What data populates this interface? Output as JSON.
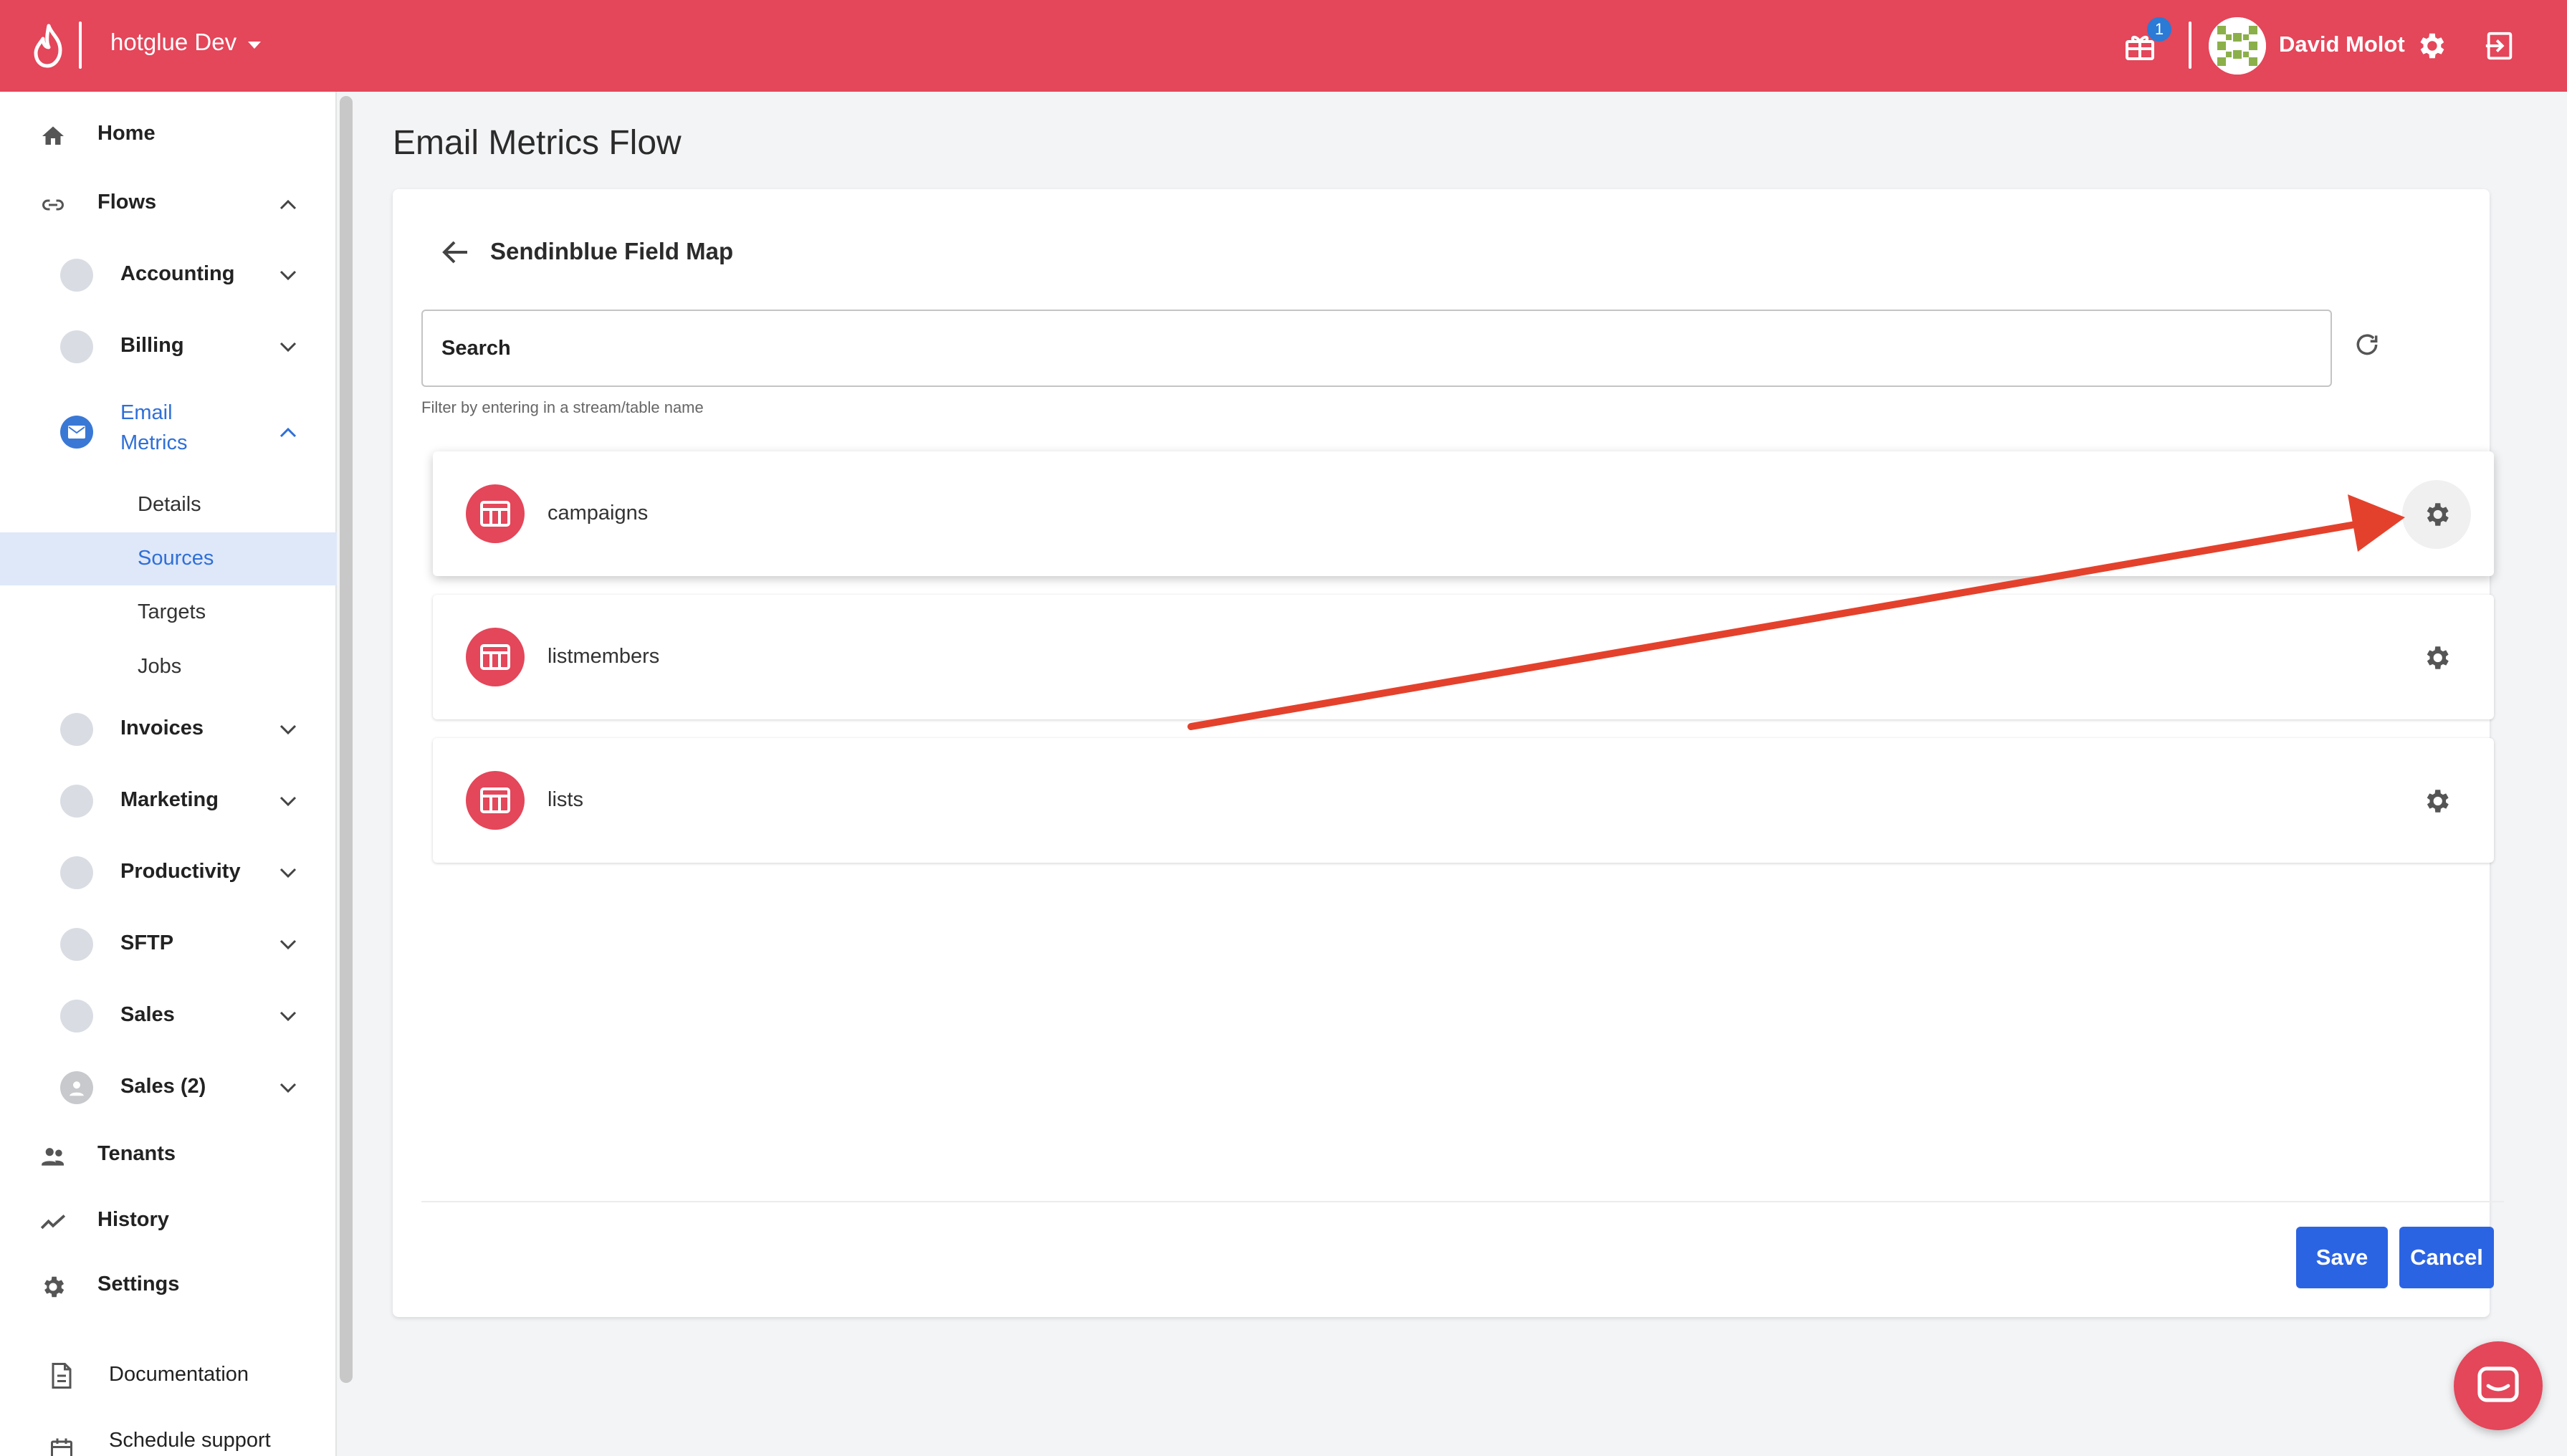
{
  "header": {
    "workspace": "hotglue Dev",
    "notification_count": "1",
    "user_name": "David Molot",
    "icons": [
      "flame-logo-icon",
      "caret-down-icon",
      "gift-icon",
      "gear-icon",
      "logout-icon"
    ],
    "brand_color": "#e4465a"
  },
  "sidebar": {
    "top_items": [
      {
        "label": "Home",
        "icon": "home-icon"
      },
      {
        "label": "Flows",
        "icon": "link-icon",
        "expanded": true
      }
    ],
    "flows": [
      {
        "label": "Accounting",
        "icon": "accounting-app-icon"
      },
      {
        "label": "Billing",
        "icon": "billing-app-icon"
      },
      {
        "label": "Email Metrics",
        "label_line1": "Email",
        "label_line2": "Metrics",
        "icon": "email-app-icon",
        "expanded": true,
        "active": true
      },
      {
        "label": "Invoices",
        "icon": "invoices-app-icon"
      },
      {
        "label": "Marketing",
        "icon": "marketing-app-icon"
      },
      {
        "label": "Productivity",
        "icon": "productivity-app-icon"
      },
      {
        "label": "SFTP",
        "icon": "sftp-app-icon"
      },
      {
        "label": "Sales",
        "icon": "sales-app-icon"
      },
      {
        "label": "Sales (2)",
        "icon": "sales2-app-icon"
      }
    ],
    "email_metrics_sub": [
      "Details",
      "Sources",
      "Targets",
      "Jobs"
    ],
    "active_sub": "Sources",
    "bottom_items": [
      {
        "label": "Tenants",
        "icon": "people-icon"
      },
      {
        "label": "History",
        "icon": "trend-icon"
      },
      {
        "label": "Settings",
        "icon": "gear-icon"
      }
    ],
    "links": [
      {
        "label": "Documentation",
        "icon": "document-icon"
      },
      {
        "label": "Schedule support",
        "icon": "calendar-icon"
      }
    ],
    "active_color": "#2f6fd8"
  },
  "main": {
    "page_title": "Email Metrics Flow",
    "panel_title": "Sendinblue Field Map",
    "search_placeholder": "Search",
    "search_helper": "Filter by entering in a stream/table name",
    "streams": [
      {
        "name": "campaigns",
        "icon": "table-icon"
      },
      {
        "name": "listmembers",
        "icon": "table-icon"
      },
      {
        "name": "lists",
        "icon": "table-icon"
      }
    ],
    "save_label": "Save",
    "cancel_label": "Cancel",
    "button_color": "#2b64e3",
    "annotation_arrow_color": "#e4412c"
  }
}
